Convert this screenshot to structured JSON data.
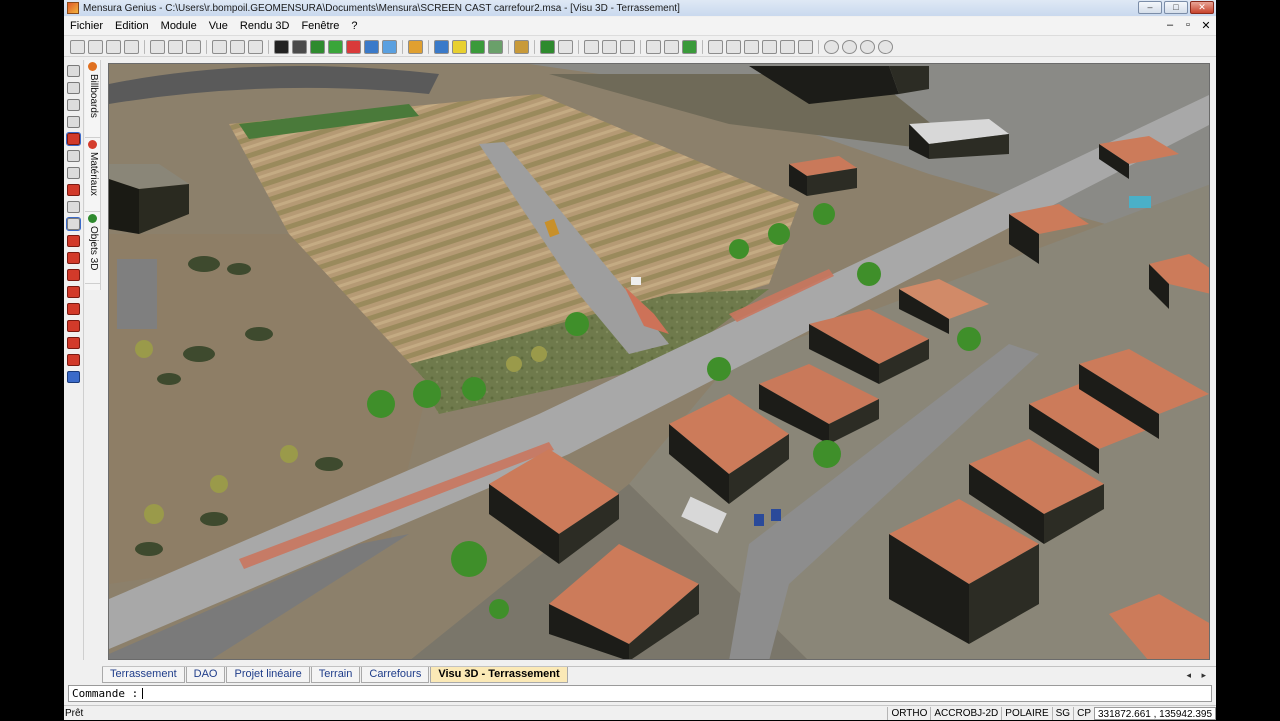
{
  "window": {
    "title": "Mensura Genius - C:\\Users\\r.bompoil.GEOMENSURA\\Documents\\Mensura\\SCREEN CAST carrefour2.msa - [Visu 3D - Terrassement]",
    "controls": {
      "minimize": "–",
      "maximize": "□",
      "close": "✕"
    }
  },
  "menu": {
    "items": [
      "Fichier",
      "Edition",
      "Module",
      "Vue",
      "Rendu 3D",
      "Fenêtre",
      "?"
    ],
    "mdi": {
      "minimize": "–",
      "restore": "▫",
      "close": "✕"
    }
  },
  "side_panels": [
    {
      "label": "Billboards",
      "icon_color": "#e07020"
    },
    {
      "label": "Matériaux",
      "icon_color": "#d43c2c"
    },
    {
      "label": "Objets 3D",
      "icon_color": "#2e8a2e"
    }
  ],
  "tabs": {
    "items": [
      "Terrassement",
      "DAO",
      "Projet linéaire",
      "Terrain",
      "Carrefours",
      "Visu 3D - Terrassement"
    ],
    "active_index": 5,
    "nav": "◂ ▸"
  },
  "command": {
    "prompt": "Commande :",
    "value": ""
  },
  "status": {
    "left": "Prêt",
    "ortho": "ORTHO",
    "accrobj": "ACCROBJ-2D",
    "polaire": "POLAIRE",
    "sg": "SG",
    "cp": "CP",
    "coords": "331872.661 , 135942.395"
  },
  "colors": {
    "active_tab": "#fbe9b6",
    "tab_text": "#1f3d8a",
    "roof": "#c9795a",
    "road": "#a9a9a9",
    "road_marking": "#d9705a",
    "tree": "#3f8f2a"
  }
}
